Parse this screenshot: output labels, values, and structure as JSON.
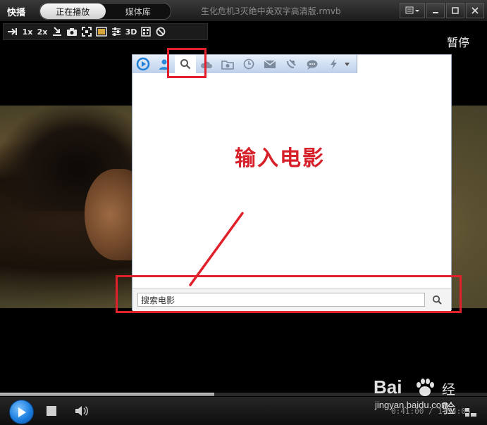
{
  "app": {
    "name": "快播",
    "tabs": [
      {
        "label": "正在播放",
        "active": true
      },
      {
        "label": "媒体库",
        "active": false
      }
    ],
    "file_title": "生化危机3灭绝中英双字高清版.rmvb"
  },
  "toolbar": {
    "items": [
      {
        "name": "pin-icon",
        "label": ""
      },
      {
        "name": "speed-1x",
        "label": "1x"
      },
      {
        "name": "speed-2x",
        "label": "2x"
      },
      {
        "name": "download-icon",
        "label": ""
      },
      {
        "name": "camera-icon",
        "label": ""
      },
      {
        "name": "fullscreen-icon",
        "label": ""
      },
      {
        "name": "image-adjust-icon",
        "label": ""
      },
      {
        "name": "equalizer-icon",
        "label": ""
      },
      {
        "name": "3d-button",
        "label": "3D"
      },
      {
        "name": "qr-icon",
        "label": ""
      },
      {
        "name": "no-ad-icon",
        "label": ""
      }
    ],
    "pause_label": "暂停"
  },
  "panel": {
    "tabs": [
      {
        "name": "qvod-icon"
      },
      {
        "name": "user-icon"
      },
      {
        "name": "search-icon",
        "active": true
      },
      {
        "name": "cloud-icon"
      },
      {
        "name": "folder-icon"
      },
      {
        "name": "history-icon"
      },
      {
        "name": "mail-icon"
      },
      {
        "name": "satellite-icon"
      },
      {
        "name": "chat-icon"
      },
      {
        "name": "lightning-icon"
      }
    ],
    "search_value": "搜索电影"
  },
  "annotation": {
    "text": "输入电影",
    "color": "#d6202a"
  },
  "player": {
    "progress": 0.44,
    "time": "0:41:00 / 1:34:05"
  },
  "watermark": {
    "brand": "Bai",
    "brand_suffix": "经验",
    "url": "jingyan.baidu.com"
  },
  "colors": {
    "accent_blue": "#1d7fe0",
    "annotation_red": "#e0202a"
  }
}
